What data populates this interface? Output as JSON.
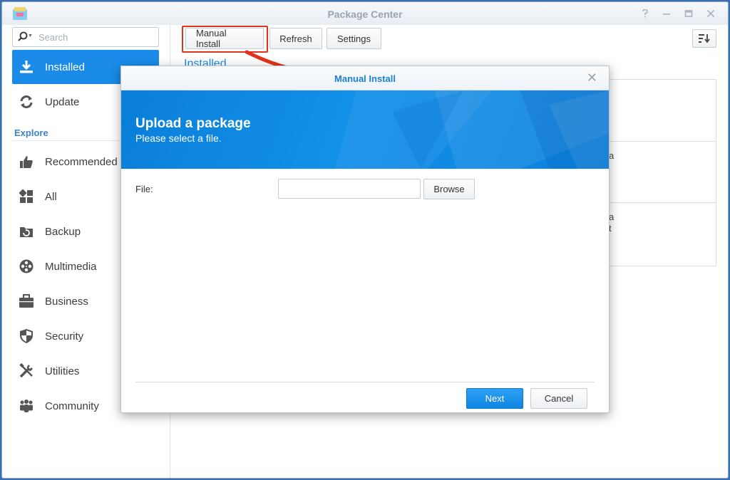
{
  "window": {
    "title": "Package Center",
    "controls": [
      "help-icon",
      "minimize-icon",
      "maximize-icon",
      "close-icon"
    ]
  },
  "sidebar": {
    "search_placeholder": "Search",
    "installed_label": "Installed",
    "update_label": "Update",
    "explore_label": "Explore",
    "items": [
      {
        "label": "Recommended",
        "icon": "thumbs-up-icon"
      },
      {
        "label": "All",
        "icon": "grid-icon"
      },
      {
        "label": "Backup",
        "icon": "backup-icon"
      },
      {
        "label": "Multimedia",
        "icon": "film-reel-icon"
      },
      {
        "label": "Business",
        "icon": "briefcase-icon"
      },
      {
        "label": "Security",
        "icon": "shield-icon"
      },
      {
        "label": "Utilities",
        "icon": "tools-icon"
      },
      {
        "label": "Community",
        "icon": "people-icon"
      }
    ]
  },
  "toolbar": {
    "manual_install_label": "Manual Install",
    "refresh_label": "Refresh",
    "settings_label": "Settings"
  },
  "content": {
    "heading": "Installed",
    "fragments": [
      "a",
      "a",
      "t"
    ]
  },
  "dialog": {
    "title": "Manual Install",
    "banner_title": "Upload a package",
    "banner_subtitle": "Please select a file.",
    "file_label": "File:",
    "file_value": "",
    "browse_label": "Browse",
    "next_label": "Next",
    "cancel_label": "Cancel"
  },
  "colors": {
    "accent": "#1a8be8",
    "annotation": "#e2321b"
  }
}
